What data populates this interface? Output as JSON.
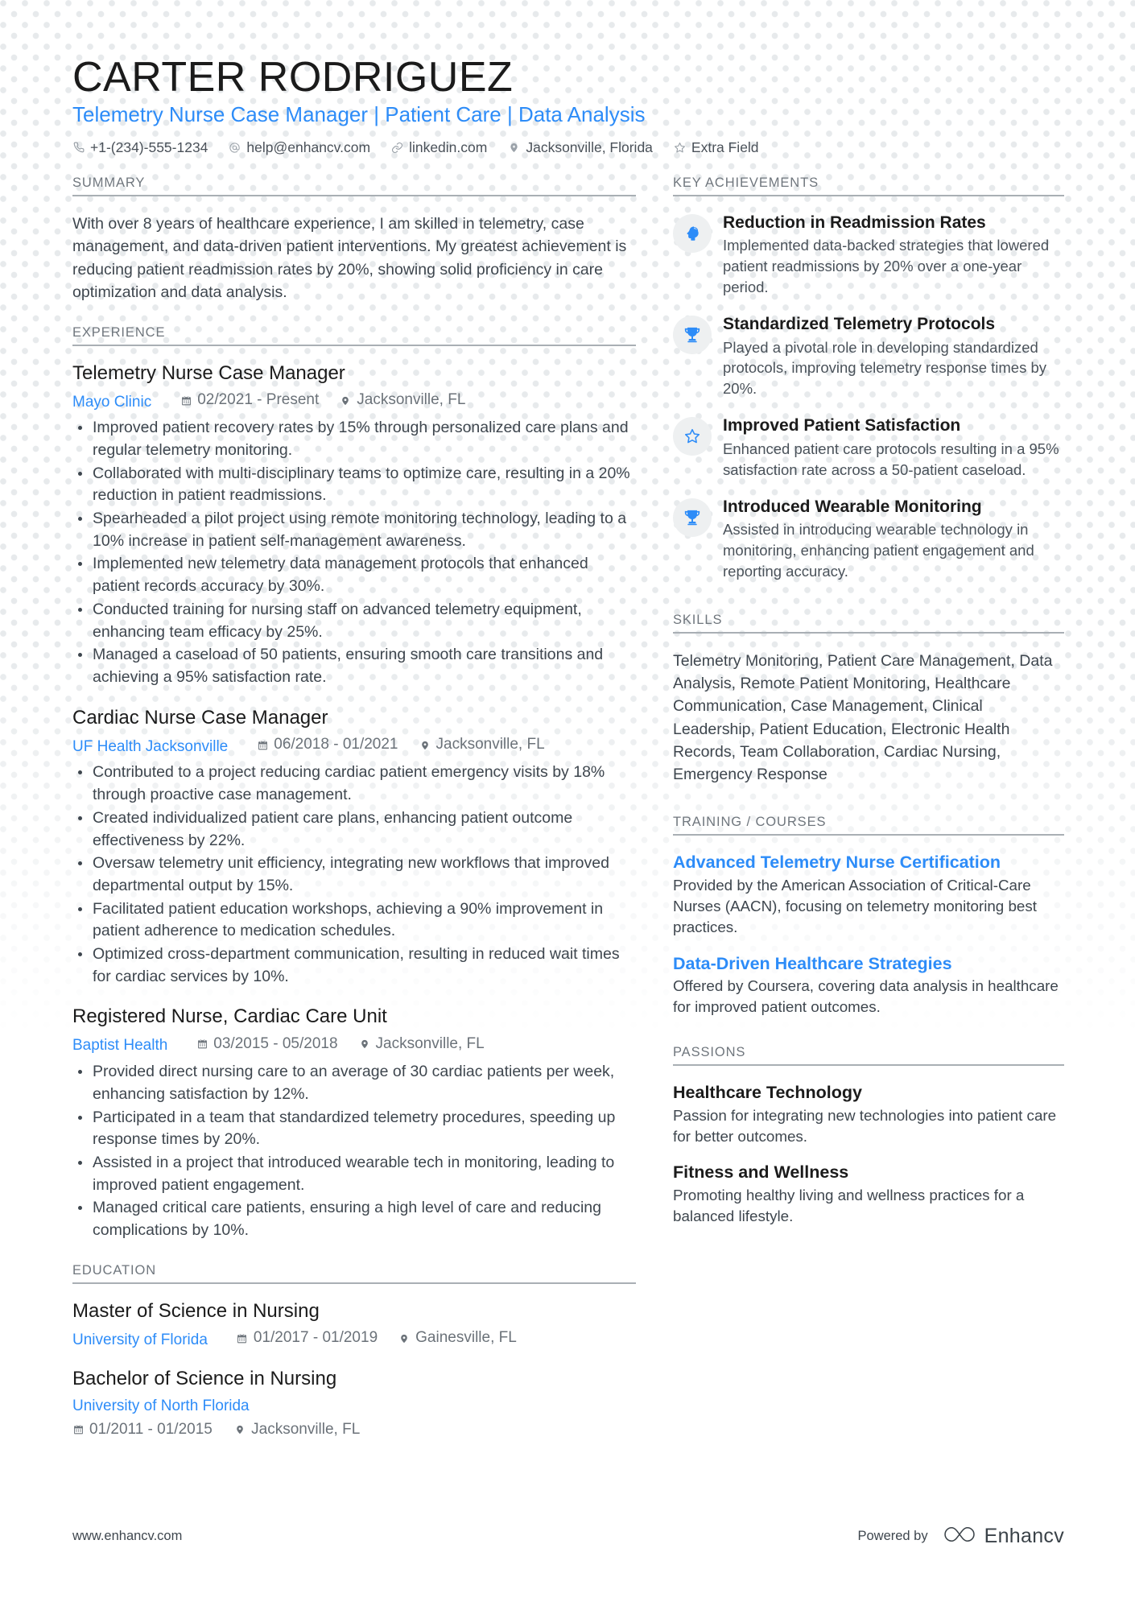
{
  "header": {
    "name": "CARTER RODRIGUEZ",
    "headline": "Telemetry Nurse Case Manager | Patient Care | Data Analysis",
    "accent_color": "#2d8cf8",
    "contacts": [
      {
        "icon": "phone-icon",
        "text": "+1-(234)-555-1234"
      },
      {
        "icon": "at-email-icon",
        "text": "help@enhancv.com"
      },
      {
        "icon": "link-icon",
        "text": "linkedin.com"
      },
      {
        "icon": "location-pin-icon",
        "text": "Jacksonville, Florida"
      },
      {
        "icon": "star-icon",
        "text": "Extra Field"
      }
    ]
  },
  "left": {
    "summary": {
      "title": "SUMMARY",
      "text": "With over 8 years of healthcare experience, I am skilled in telemetry, case management, and data-driven patient interventions. My greatest achievement is reducing patient readmission rates by 20%, showing solid proficiency in care optimization and data analysis."
    },
    "experience": {
      "title": "EXPERIENCE",
      "entries": [
        {
          "role": "Telemetry Nurse Case Manager",
          "org": "Mayo Clinic",
          "dates": "02/2021 - Present",
          "location": "Jacksonville, FL",
          "bullets": [
            "Improved patient recovery rates by 15% through personalized care plans and regular telemetry monitoring.",
            "Collaborated with multi-disciplinary teams to optimize care, resulting in a 20% reduction in patient readmissions.",
            "Spearheaded a pilot project using remote monitoring technology, leading to a 10% increase in patient self-management awareness.",
            "Implemented new telemetry data management protocols that enhanced patient records accuracy by 30%.",
            "Conducted training for nursing staff on advanced telemetry equipment, enhancing team efficacy by 25%.",
            "Managed a caseload of 50 patients, ensuring smooth care transitions and achieving a 95% satisfaction rate."
          ]
        },
        {
          "role": "Cardiac Nurse Case Manager",
          "org": "UF Health Jacksonville",
          "dates": "06/2018 - 01/2021",
          "location": "Jacksonville, FL",
          "bullets": [
            "Contributed to a project reducing cardiac patient emergency visits by 18% through proactive case management.",
            "Created individualized patient care plans, enhancing patient outcome effectiveness by 22%.",
            "Oversaw telemetry unit efficiency, integrating new workflows that improved departmental output by 15%.",
            "Facilitated patient education workshops, achieving a 90% improvement in patient adherence to medication schedules.",
            "Optimized cross-department communication, resulting in reduced wait times for cardiac services by 10%."
          ]
        },
        {
          "role": "Registered Nurse, Cardiac Care Unit",
          "org": "Baptist Health",
          "dates": "03/2015 - 05/2018",
          "location": "Jacksonville, FL",
          "bullets": [
            "Provided direct nursing care to an average of 30 cardiac patients per week, enhancing satisfaction by 12%.",
            "Participated in a team that standardized telemetry procedures, speeding up response times by 20%.",
            "Assisted in a project that introduced wearable tech in monitoring, leading to improved patient engagement.",
            "Managed critical care patients, ensuring a high level of care and reducing complications by 10%."
          ]
        }
      ]
    },
    "education": {
      "title": "EDUCATION",
      "entries": [
        {
          "degree": "Master of Science in Nursing",
          "org": "University of Florida",
          "dates": "01/2017 - 01/2019",
          "location": "Gainesville, FL",
          "stacked": false
        },
        {
          "degree": "Bachelor of Science in Nursing",
          "org": "University of North Florida",
          "dates": "01/2011 - 01/2015",
          "location": "Jacksonville, FL",
          "stacked": true
        }
      ]
    }
  },
  "right": {
    "achievements": {
      "title": "KEY ACHIEVEMENTS",
      "items": [
        {
          "icon": "brain-head-icon",
          "title": "Reduction in Readmission Rates",
          "desc": "Implemented data-backed strategies that lowered patient readmissions by 20% over a one-year period."
        },
        {
          "icon": "trophy-icon",
          "title": "Standardized Telemetry Protocols",
          "desc": "Played a pivotal role in developing standardized protocols, improving telemetry response times by 20%."
        },
        {
          "icon": "star-outline-icon",
          "title": "Improved Patient Satisfaction",
          "desc": "Enhanced patient care protocols resulting in a 95% satisfaction rate across a 50-patient caseload."
        },
        {
          "icon": "trophy-icon",
          "title": "Introduced Wearable Monitoring",
          "desc": "Assisted in introducing wearable technology in monitoring, enhancing patient engagement and reporting accuracy."
        }
      ]
    },
    "skills": {
      "title": "SKILLS",
      "text": "Telemetry Monitoring, Patient Care Management, Data Analysis, Remote Patient Monitoring, Healthcare Communication, Case Management, Clinical Leadership, Patient Education, Electronic Health Records, Team Collaboration, Cardiac Nursing, Emergency Response"
    },
    "training": {
      "title": "TRAINING / COURSES",
      "items": [
        {
          "title": "Advanced Telemetry Nurse Certification",
          "desc": "Provided by the American Association of Critical-Care Nurses (AACN), focusing on telemetry monitoring best practices."
        },
        {
          "title": "Data-Driven Healthcare Strategies",
          "desc": "Offered by Coursera, covering data analysis in healthcare for improved patient outcomes."
        }
      ]
    },
    "passions": {
      "title": "PASSIONS",
      "items": [
        {
          "title": "Healthcare Technology",
          "desc": "Passion for integrating new technologies into patient care for better outcomes."
        },
        {
          "title": "Fitness and Wellness",
          "desc": "Promoting healthy living and wellness practices for a balanced lifestyle."
        }
      ]
    }
  },
  "footer": {
    "url": "www.enhancv.com",
    "powered_by": "Powered by",
    "brand": "Enhancv"
  }
}
